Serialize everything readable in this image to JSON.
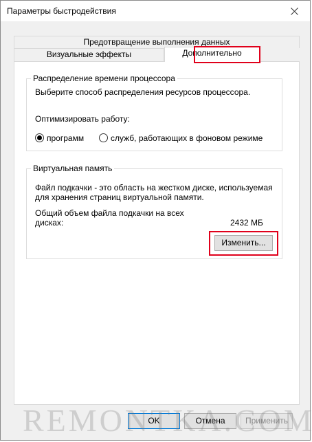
{
  "window": {
    "title": "Параметры быстродействия",
    "close_icon": "close-icon"
  },
  "tabs": {
    "top_row": "Предотвращение выполнения данных",
    "visual_effects": "Визуальные эффекты",
    "advanced": "Дополнительно"
  },
  "cpu_group": {
    "title": "Распределение времени процессора",
    "description": "Выберите способ распределения ресурсов процессора.",
    "optimize_label": "Оптимизировать работу:",
    "options": [
      {
        "label": "программ",
        "checked": true
      },
      {
        "label": "служб, работающих в фоновом режиме",
        "checked": false
      }
    ]
  },
  "vm_group": {
    "title": "Виртуальная память",
    "description_line1": "Файл подкачки - это область на жестком диске, используемая",
    "description_line2": "для хранения страниц виртуальной памяти.",
    "total_label_line1": "Общий объем файла подкачки на всех",
    "total_label_line2": "дисках:",
    "total_value": "2432 МБ",
    "change_button": "Изменить..."
  },
  "buttons": {
    "ok": "OK",
    "cancel": "Отмена",
    "apply": "Применить"
  },
  "watermark": "REMONTKA.COM",
  "colors": {
    "highlight": "#e0001b",
    "focus": "#0078d7"
  }
}
